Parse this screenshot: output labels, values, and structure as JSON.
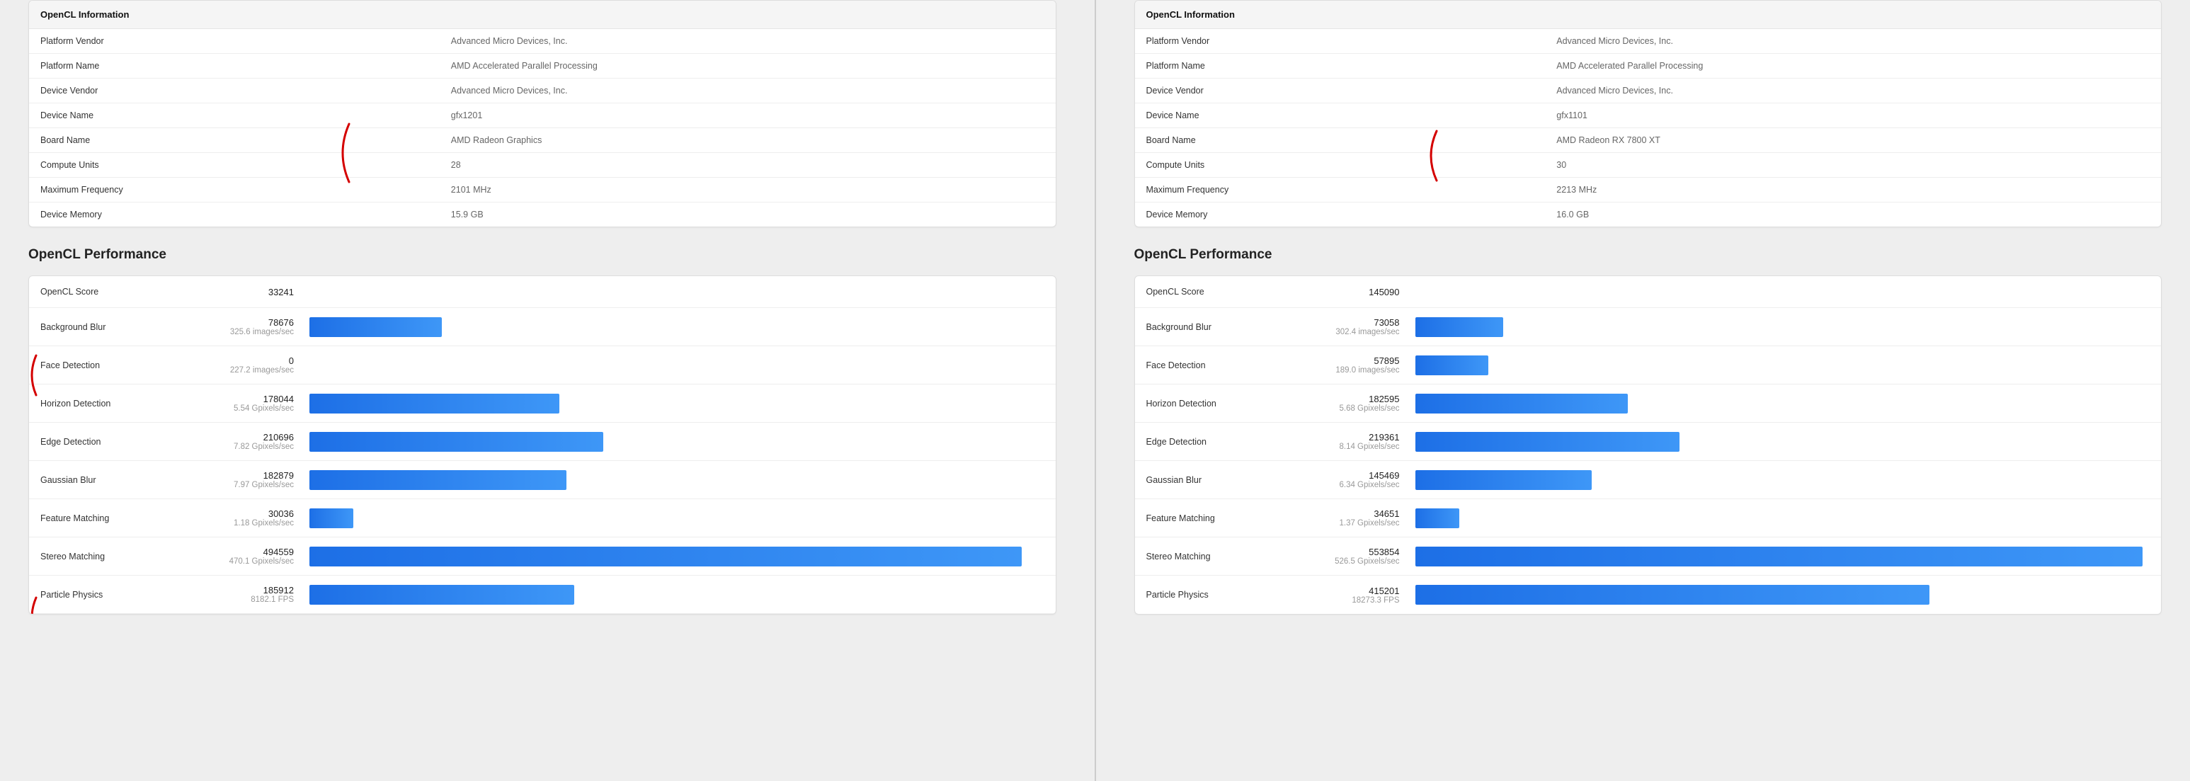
{
  "left": {
    "info": {
      "header": "OpenCL Information",
      "rows": [
        {
          "label": "Platform Vendor",
          "value": "Advanced Micro Devices, Inc."
        },
        {
          "label": "Platform Name",
          "value": "AMD Accelerated Parallel Processing"
        },
        {
          "label": "Device Vendor",
          "value": "Advanced Micro Devices, Inc."
        },
        {
          "label": "Device Name",
          "value": "gfx1201"
        },
        {
          "label": "Board Name",
          "value": "AMD Radeon Graphics"
        },
        {
          "label": "Compute Units",
          "value": "28"
        },
        {
          "label": "Maximum Frequency",
          "value": "2101 MHz"
        },
        {
          "label": "Device Memory",
          "value": "15.9 GB"
        }
      ]
    },
    "perf": {
      "title": "OpenCL Performance",
      "score_label": "OpenCL Score",
      "score": "33241",
      "rows": [
        {
          "name": "Background Blur",
          "score": "78676",
          "sub": "325.6 images/sec",
          "bar": 18
        },
        {
          "name": "Face Detection",
          "score": "0",
          "sub": "227.2 images/sec",
          "bar": 0
        },
        {
          "name": "Horizon Detection",
          "score": "178044",
          "sub": "5.54 Gpixels/sec",
          "bar": 34
        },
        {
          "name": "Edge Detection",
          "score": "210696",
          "sub": "7.82 Gpixels/sec",
          "bar": 40
        },
        {
          "name": "Gaussian Blur",
          "score": "182879",
          "sub": "7.97 Gpixels/sec",
          "bar": 35
        },
        {
          "name": "Feature Matching",
          "score": "30036",
          "sub": "1.18 Gpixels/sec",
          "bar": 6
        },
        {
          "name": "Stereo Matching",
          "score": "494559",
          "sub": "470.1 Gpixels/sec",
          "bar": 97
        },
        {
          "name": "Particle Physics",
          "score": "185912",
          "sub": "8182.1 FPS",
          "bar": 36
        }
      ]
    }
  },
  "right": {
    "info": {
      "header": "OpenCL Information",
      "rows": [
        {
          "label": "Platform Vendor",
          "value": "Advanced Micro Devices, Inc."
        },
        {
          "label": "Platform Name",
          "value": "AMD Accelerated Parallel Processing"
        },
        {
          "label": "Device Vendor",
          "value": "Advanced Micro Devices, Inc."
        },
        {
          "label": "Device Name",
          "value": "gfx1101"
        },
        {
          "label": "Board Name",
          "value": "AMD Radeon RX 7800 XT"
        },
        {
          "label": "Compute Units",
          "value": "30"
        },
        {
          "label": "Maximum Frequency",
          "value": "2213 MHz"
        },
        {
          "label": "Device Memory",
          "value": "16.0 GB"
        }
      ]
    },
    "perf": {
      "title": "OpenCL Performance",
      "score_label": "OpenCL Score",
      "score": "145090",
      "rows": [
        {
          "name": "Background Blur",
          "score": "73058",
          "sub": "302.4 images/sec",
          "bar": 12
        },
        {
          "name": "Face Detection",
          "score": "57895",
          "sub": "189.0 images/sec",
          "bar": 10
        },
        {
          "name": "Horizon Detection",
          "score": "182595",
          "sub": "5.68 Gpixels/sec",
          "bar": 29
        },
        {
          "name": "Edge Detection",
          "score": "219361",
          "sub": "8.14 Gpixels/sec",
          "bar": 36
        },
        {
          "name": "Gaussian Blur",
          "score": "145469",
          "sub": "6.34 Gpixels/sec",
          "bar": 24
        },
        {
          "name": "Feature Matching",
          "score": "34651",
          "sub": "1.37 Gpixels/sec",
          "bar": 6
        },
        {
          "name": "Stereo Matching",
          "score": "553854",
          "sub": "526.5 Gpixels/sec",
          "bar": 99
        },
        {
          "name": "Particle Physics",
          "score": "415201",
          "sub": "18273.3 FPS",
          "bar": 70
        }
      ]
    }
  },
  "chart_data": [
    {
      "type": "bar",
      "title": "OpenCL Performance (left / gfx1201)",
      "xlabel": "",
      "ylabel": "Score",
      "overall_score": 33241,
      "categories": [
        "Background Blur",
        "Face Detection",
        "Horizon Detection",
        "Edge Detection",
        "Gaussian Blur",
        "Feature Matching",
        "Stereo Matching",
        "Particle Physics"
      ],
      "values": [
        78676,
        0,
        178044,
        210696,
        182879,
        30036,
        494559,
        185912
      ],
      "subvalues": [
        "325.6 images/sec",
        "227.2 images/sec",
        "5.54 Gpixels/sec",
        "7.82 Gpixels/sec",
        "7.97 Gpixels/sec",
        "1.18 Gpixels/sec",
        "470.1 Gpixels/sec",
        "8182.1 FPS"
      ]
    },
    {
      "type": "bar",
      "title": "OpenCL Performance (right / gfx1101)",
      "xlabel": "",
      "ylabel": "Score",
      "overall_score": 145090,
      "categories": [
        "Background Blur",
        "Face Detection",
        "Horizon Detection",
        "Edge Detection",
        "Gaussian Blur",
        "Feature Matching",
        "Stereo Matching",
        "Particle Physics"
      ],
      "values": [
        73058,
        57895,
        182595,
        219361,
        145469,
        34651,
        553854,
        415201
      ],
      "subvalues": [
        "302.4 images/sec",
        "189.0 images/sec",
        "5.68 Gpixels/sec",
        "8.14 Gpixels/sec",
        "6.34 Gpixels/sec",
        "1.37 Gpixels/sec",
        "526.5 Gpixels/sec",
        "18273.3 FPS"
      ]
    }
  ]
}
